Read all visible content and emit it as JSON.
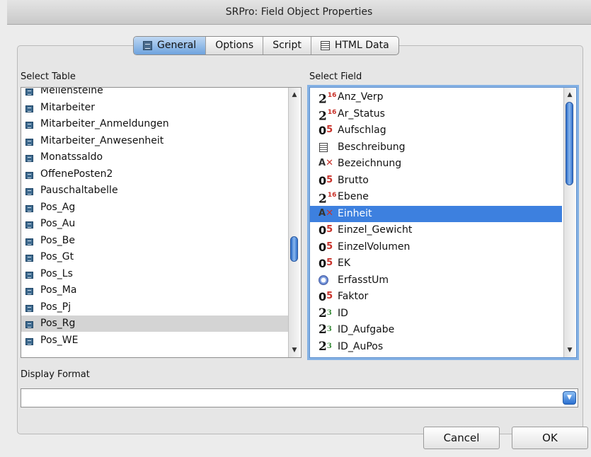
{
  "window": {
    "title": "SRPro: Field Object Properties"
  },
  "tabs": [
    {
      "label": "General",
      "icon": "table-icon",
      "active": true
    },
    {
      "label": "Options",
      "icon": "",
      "active": false
    },
    {
      "label": "Script",
      "icon": "",
      "active": false
    },
    {
      "label": "HTML Data",
      "icon": "memo-icon",
      "active": false
    }
  ],
  "select_table": {
    "label": "Select Table",
    "selected": "Pos_Rg",
    "items": [
      "Meilensteine",
      "Mitarbeiter",
      "Mitarbeiter_Anmeldungen",
      "Mitarbeiter_Anwesenheit",
      "Monatssaldo",
      "OffenePosten2",
      "Pauschaltabelle",
      "Pos_Ag",
      "Pos_Au",
      "Pos_Be",
      "Pos_Gt",
      "Pos_Ls",
      "Pos_Ma",
      "Pos_Pj",
      "Pos_Rg",
      "Pos_WE"
    ]
  },
  "select_field": {
    "label": "Select Field",
    "selected": "Einheit",
    "items": [
      {
        "name": "Anz_Verp",
        "type": "integer",
        "num": "2",
        "sup": "16"
      },
      {
        "name": "Ar_Status",
        "type": "integer",
        "num": "2",
        "sup": "16"
      },
      {
        "name": "Aufschlag",
        "type": "real",
        "num": "0",
        "sup": "5"
      },
      {
        "name": "Beschreibung",
        "type": "memo"
      },
      {
        "name": "Bezeichnung",
        "type": "text"
      },
      {
        "name": "Brutto",
        "type": "real",
        "num": "0",
        "sup": "5"
      },
      {
        "name": "Ebene",
        "type": "integer",
        "num": "2",
        "sup": "16"
      },
      {
        "name": "Einheit",
        "type": "text"
      },
      {
        "name": "Einzel_Gewicht",
        "type": "real",
        "num": "0",
        "sup": "5"
      },
      {
        "name": "EinzelVolumen",
        "type": "real",
        "num": "0",
        "sup": "5"
      },
      {
        "name": "EK",
        "type": "real",
        "num": "0",
        "sup": "5"
      },
      {
        "name": "ErfasstUm",
        "type": "time"
      },
      {
        "name": "Faktor",
        "type": "real",
        "num": "0",
        "sup": "5"
      },
      {
        "name": "ID",
        "type": "counter",
        "num": "2",
        "sup": "3"
      },
      {
        "name": "ID_Aufgabe",
        "type": "counter",
        "num": "2",
        "sup": "3"
      },
      {
        "name": "ID_AuPos",
        "type": "counter",
        "num": "2",
        "sup": "3"
      }
    ]
  },
  "display_format": {
    "label": "Display Format",
    "value": ""
  },
  "buttons": {
    "cancel": "Cancel",
    "ok": "OK"
  },
  "colors": {
    "selection_blue": "#3d80df",
    "selection_gray": "#d4d4d4",
    "accent_red": "#c8322a"
  }
}
